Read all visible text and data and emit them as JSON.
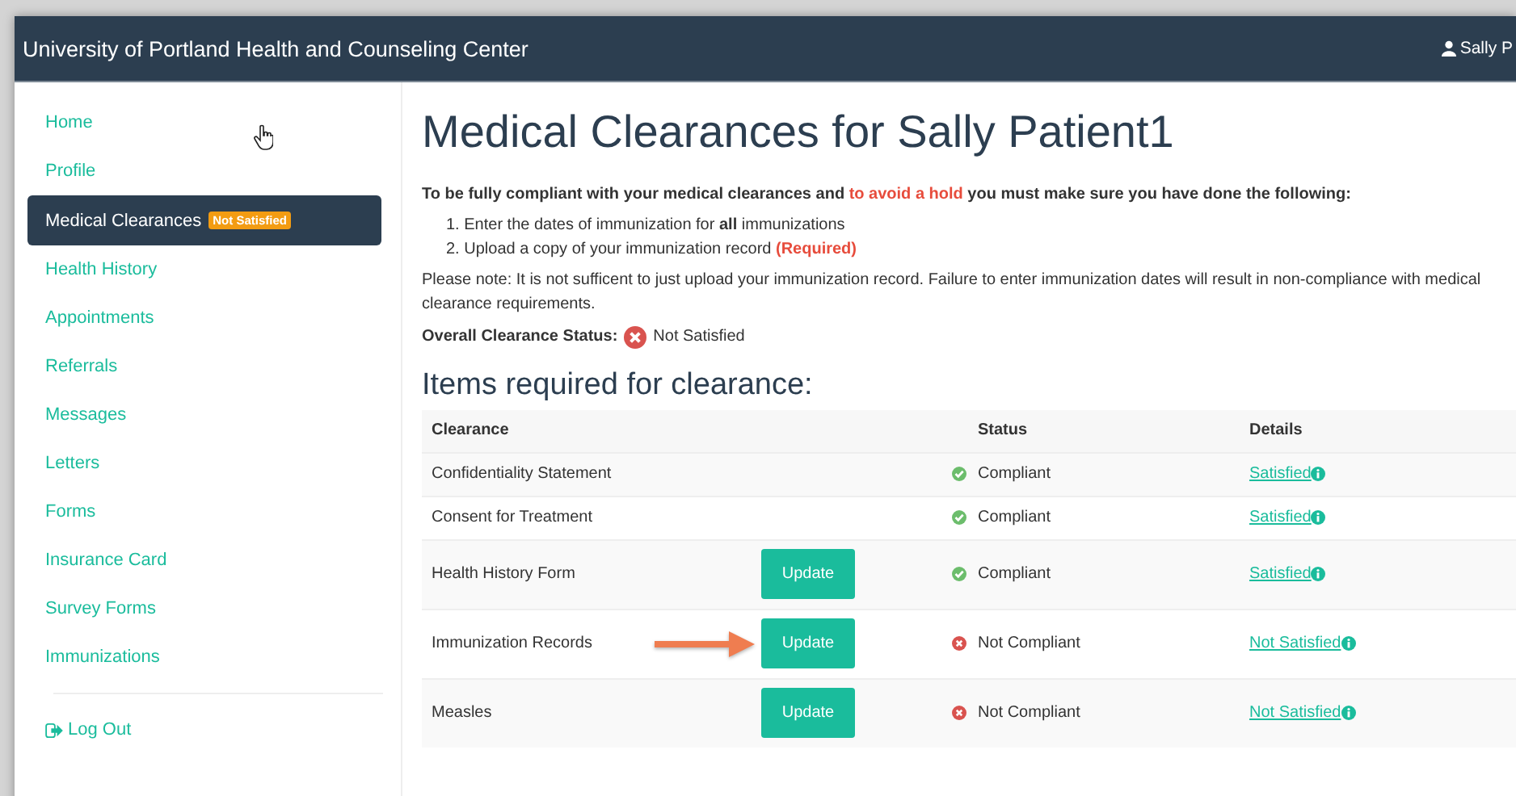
{
  "header": {
    "title": "University of Portland Health and Counseling Center",
    "user": "Sally P"
  },
  "sidebar": {
    "items": [
      {
        "label": "Home",
        "selected": false
      },
      {
        "label": "Profile",
        "selected": false
      },
      {
        "label": "Medical Clearances",
        "selected": true,
        "badge": "Not Satisfied"
      },
      {
        "label": "Health History",
        "selected": false
      },
      {
        "label": "Appointments",
        "selected": false
      },
      {
        "label": "Referrals",
        "selected": false
      },
      {
        "label": "Messages",
        "selected": false
      },
      {
        "label": "Letters",
        "selected": false
      },
      {
        "label": "Forms",
        "selected": false
      },
      {
        "label": "Insurance Card",
        "selected": false
      },
      {
        "label": "Survey Forms",
        "selected": false
      },
      {
        "label": "Immunizations",
        "selected": false
      }
    ],
    "logout": "Log Out"
  },
  "page": {
    "title": "Medical Clearances for Sally Patient1",
    "intro": [
      {
        "text": "To be fully compliant with your medical clearances and ",
        "kind": "plain"
      },
      {
        "text": "to avoid a hold",
        "kind": "warning"
      },
      {
        "text": " you must make sure you have done the following:",
        "kind": "plain"
      }
    ],
    "steps": [
      [
        {
          "text": "1. ",
          "kind": "plain"
        },
        {
          "text": "Enter the dates of immunization for ",
          "kind": "plain"
        },
        {
          "text": "all",
          "kind": "strong"
        },
        {
          "text": " immunizations",
          "kind": "plain"
        }
      ],
      [
        {
          "text": "2. ",
          "kind": "plain"
        },
        {
          "text": "Upload a copy of your immunization record ",
          "kind": "plain"
        },
        {
          "text": "(Required)",
          "kind": "warning"
        }
      ]
    ],
    "note": "Please note: It is not sufficent to just upload your immunization record. Failure to enter immunization dates will result in non-compliance with medical clearance requirements.",
    "overall_label": "Overall Clearance Status:",
    "overall_compliant": false,
    "overall_status": "Not Satisfied"
  },
  "table": {
    "heading": "Items required for clearance:",
    "columns": [
      "Clearance",
      "Status",
      "Details"
    ],
    "rows": [
      {
        "name": "Confidentiality Statement",
        "compliant": true,
        "status": "Compliant",
        "details": "Satisfied",
        "pointed_at": false
      },
      {
        "name": "Consent for Treatment",
        "compliant": true,
        "status": "Compliant",
        "details": "Satisfied",
        "pointed_at": false
      },
      {
        "name": "Health History Form",
        "action": "Update",
        "compliant": true,
        "status": "Compliant",
        "details": "Satisfied",
        "pointed_at": false
      },
      {
        "name": "Immunization Records",
        "action": "Update",
        "compliant": false,
        "status": "Not Compliant",
        "details": "Not Satisfied",
        "pointed_at": true
      },
      {
        "name": "Measles",
        "action": "Update",
        "compliant": false,
        "status": "Not Compliant",
        "details": "Not Satisfied",
        "pointed_at": false
      }
    ]
  }
}
